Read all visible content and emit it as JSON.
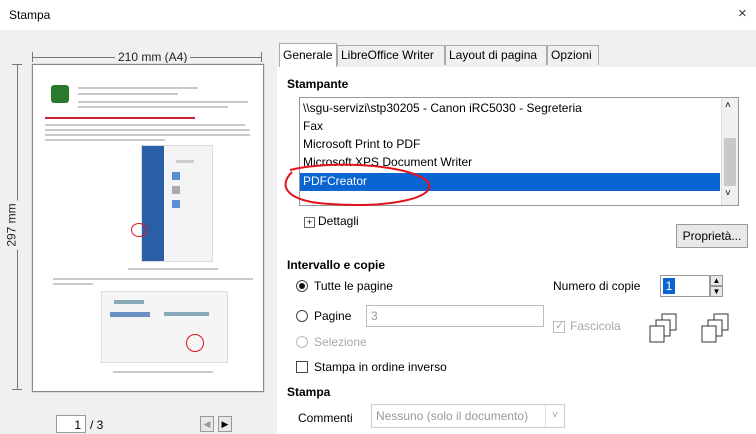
{
  "window": {
    "title": "Stampa",
    "close_glyph": "×"
  },
  "preview": {
    "paper_width": "210 mm (A4)",
    "paper_height": "297 mm",
    "page_number": "1",
    "page_total": "/ 3"
  },
  "tabs": [
    {
      "label": "Generale"
    },
    {
      "label": "LibreOffice Writer"
    },
    {
      "label": "Layout di pagina"
    },
    {
      "label": "Opzioni"
    }
  ],
  "printer": {
    "section_title": "Stampante",
    "items": [
      "\\\\sgu-servizi\\stp30205 - Canon iRC5030 - Segreteria",
      "Fax",
      "Microsoft Print to PDF",
      "Microsoft XPS Document Writer",
      "PDFCreator"
    ],
    "selected": "PDFCreator",
    "details_label": "Dettagli",
    "properties_button": "Proprietà..."
  },
  "range": {
    "section_title": "Intervallo e copie",
    "all_pages": "Tutte le pagine",
    "pages_label": "Pagine",
    "pages_value": "3",
    "selection_label": "Selezione",
    "reverse_label": "Stampa in ordine inverso",
    "copies_label": "Numero di copie",
    "copies_value": "1",
    "collate_label": "Fascicola"
  },
  "print": {
    "section_title": "Stampa",
    "comments_label": "Commenti",
    "comments_value": "Nessuno (solo il documento)"
  },
  "colors": {
    "selection": "#0a64d2",
    "annotation": "#e0141e"
  }
}
